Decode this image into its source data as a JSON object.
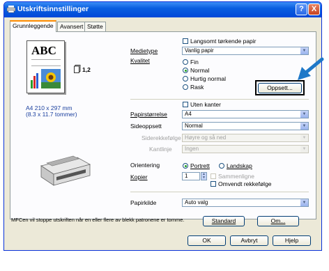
{
  "window": {
    "title": "Utskriftsinnstillinger",
    "help_btn": "?",
    "close_btn": "X"
  },
  "tabs": [
    "Grunnleggende",
    "Avansert",
    "Støtte"
  ],
  "preview": {
    "abc": "ABC",
    "copies": "1,2",
    "paper_mm": "A4 210 x 297 mm",
    "paper_in": "(8.3 x 11.7 tommer)"
  },
  "settings": {
    "slow_drying": "Langsomt tørkende papir",
    "media_label": "Medietype",
    "media_value": "Vanlig papir",
    "quality_label": "Kvalitet",
    "quality_options": [
      "Fin",
      "Normal",
      "Hurtig normal",
      "Rask"
    ],
    "setup_button": "Oppsett...",
    "borderless": "Uten kanter",
    "paper_size_label": "Papirstørrelse",
    "paper_size_value": "A4",
    "page_setup_label": "Sideoppsett",
    "page_setup_value": "Normal",
    "page_order_label": "Siderekkefølge",
    "page_order_value": "Høyre og så ned",
    "border_line_label": "Kantlinje",
    "border_line_value": "Ingen",
    "orientation_label": "Orientering",
    "orientation_portrait": "Portrett",
    "orientation_landscape": "Landskap",
    "copies_label": "Kopier",
    "copies_value": "1",
    "collate": "Sammenligne",
    "reverse_order": "Omvendt rekkefølge",
    "paper_source_label": "Papirkilde",
    "paper_source_value": "Auto valg"
  },
  "footer": {
    "message": "MFCen vil stoppe utskriften når en eller flere av blekk patronene er tomme.",
    "standard_button": "Standard",
    "about_button": "Om...",
    "ok_button": "OK",
    "cancel_button": "Avbryt",
    "help_button": "Hjelp"
  },
  "colors": {
    "titlebar": "#0054e3",
    "arrow": "#1e78c8",
    "highlight_box": "#000000"
  }
}
